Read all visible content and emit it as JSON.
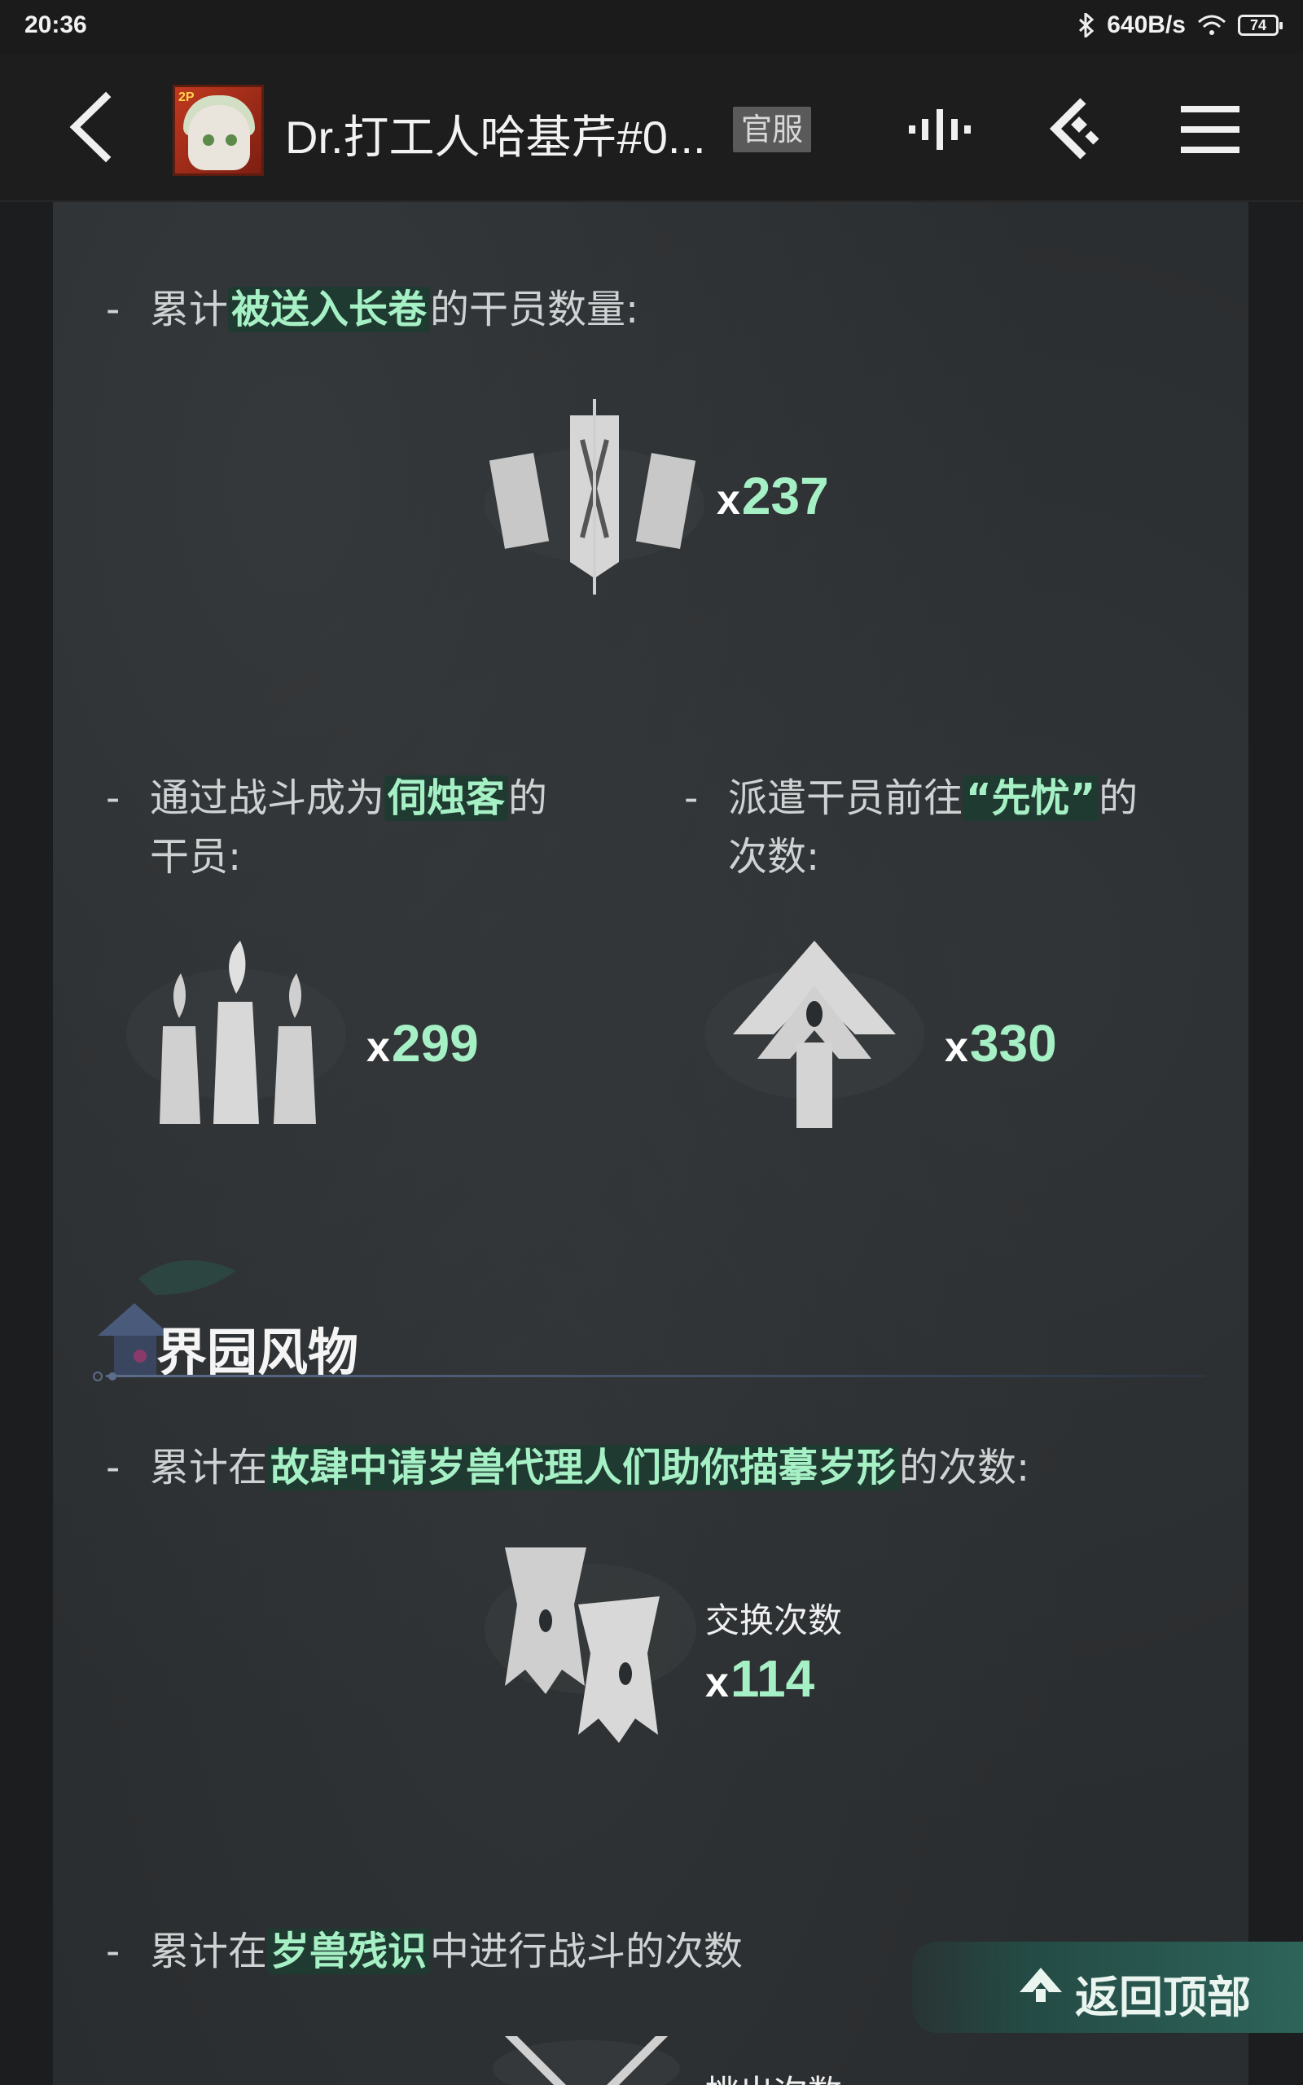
{
  "status_bar": {
    "time": "20:36",
    "network_speed": "640B/s",
    "battery": "74",
    "icons": [
      "bluetooth-icon",
      "wifi-icon",
      "battery-icon"
    ]
  },
  "nav": {
    "title": "Dr.打工人哈基芹#0...",
    "server_badge": "官服",
    "icons": [
      "back-arrow-icon",
      "waveform-icon",
      "share-icon",
      "menu-icon"
    ]
  },
  "sections": {
    "scroll": {
      "label_prefix": "累计",
      "label_highlight": "被送入长卷",
      "label_suffix": "的干员数量:",
      "value": "237"
    },
    "candle": {
      "label_prefix": "通过战斗成为",
      "label_highlight": "伺烛客",
      "label_suffix": "的",
      "label_line2": "干员:",
      "value": "299"
    },
    "worry": {
      "label_prefix": "派遣干员前往",
      "label_highlight": "“先忧”",
      "label_suffix": "的",
      "label_line2": "次数:",
      "value": "330"
    },
    "garden": {
      "title": "界园风物",
      "label_prefix": "累计在",
      "label_highlight": "故肆中请岁兽代理人们助你描摹岁形",
      "label_suffix": "的次数:",
      "caption": "交换次数",
      "value": "114"
    },
    "battle": {
      "label_prefix": "累计在",
      "label_highlight": "岁兽残识",
      "label_suffix": "中进行战斗的次数",
      "caption_partial": "挑出次数"
    }
  },
  "back_to_top": {
    "label": "返回顶部"
  },
  "colors": {
    "highlight_text": "#a6f0c5",
    "highlight_bg": "#1f3a31",
    "panel": "#2a2d2f"
  }
}
